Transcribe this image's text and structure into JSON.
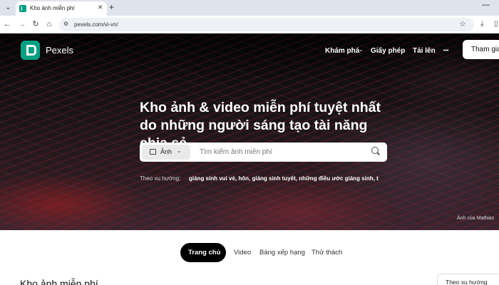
{
  "browser": {
    "tab_title": "Kho ảnh miễn phí",
    "tab_close": "✕",
    "new_tab": "+",
    "url": "pexels.com/vi-vn/"
  },
  "header": {
    "brand": "Pexels",
    "nav": [
      "Khám phá",
      "Giấy phép",
      "Tải lên",
      "•••"
    ],
    "join": "Tham gia"
  },
  "hero": {
    "headline": "Kho ảnh & video miễn phí tuyệt nhất do những người sáng tạo tài năng chia sẻ.",
    "search_type": "Ảnh",
    "search_placeholder": "Tìm kiếm ảnh miễn phí",
    "trending_label": "Theo xu hướng:",
    "trending_terms": "giáng sinh vui vẻ, hôn, giáng sinh tuyết, những điều ước giáng sinh, t",
    "photo_credit": "Ảnh của Mathias"
  },
  "content_tabs": {
    "items": [
      "Trang chủ",
      "Video",
      "Bảng xếp hạng",
      "Thử thách"
    ],
    "active": "Trang chủ"
  },
  "section": {
    "title": "Kho ảnh miễn phí",
    "sort": "Theo xu hướng"
  }
}
